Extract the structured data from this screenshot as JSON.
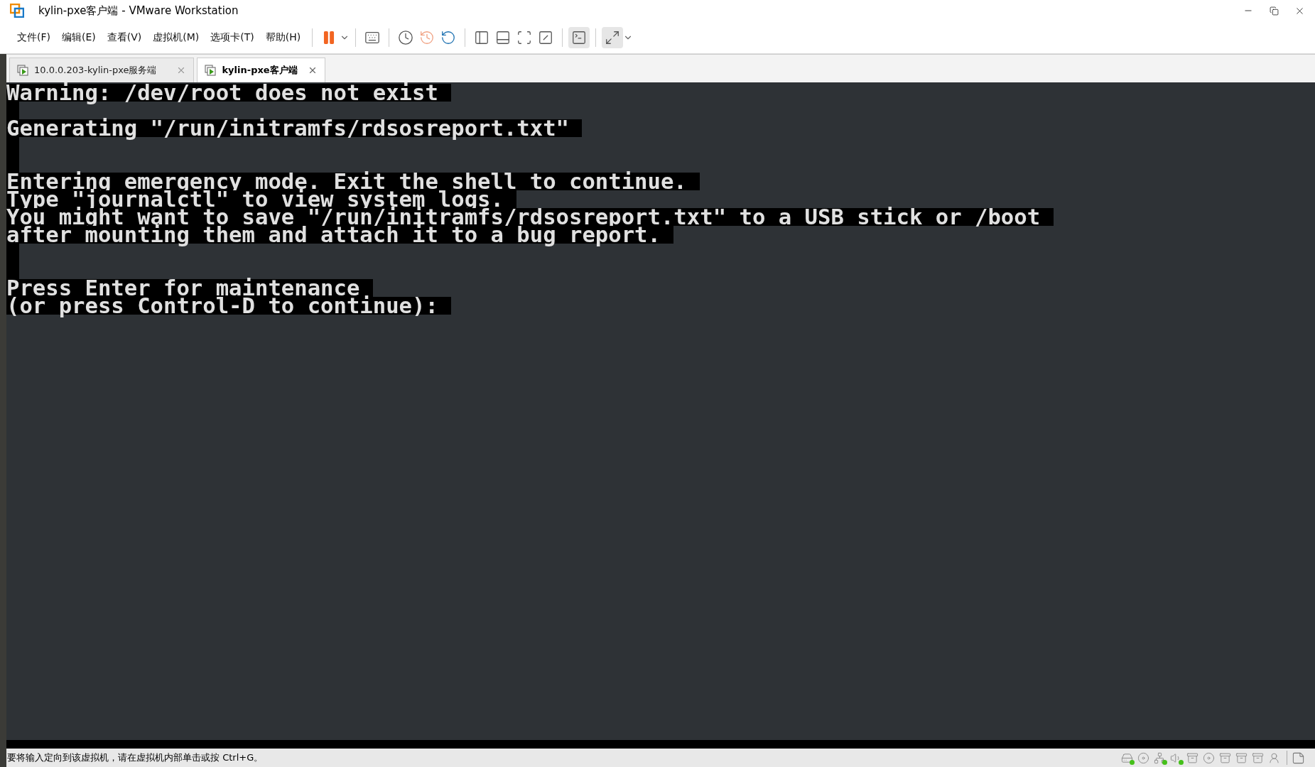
{
  "window": {
    "title": "kylin-pxe客户端 - VMware Workstation"
  },
  "menu": [
    "文件(F)",
    "编辑(E)",
    "查看(V)",
    "虚拟机(M)",
    "选项卡(T)",
    "帮助(H)"
  ],
  "tabs": [
    {
      "label": "10.0.0.203-kylin-pxe服务端",
      "selected": false
    },
    {
      "label": "kylin-pxe客户端",
      "selected": true
    }
  ],
  "console": {
    "lines": [
      {
        "kind": "text",
        "text": "Warning: /dev/root does not exist "
      },
      {
        "kind": "blank"
      },
      {
        "kind": "text",
        "text": "Generating \"/run/initramfs/rdsosreport.txt\" "
      },
      {
        "kind": "blank"
      },
      {
        "kind": "blank"
      },
      {
        "kind": "text",
        "text": "Entering emergency mode. Exit the shell to continue. "
      },
      {
        "kind": "text",
        "text": "Type \"journalctl\" to view system logs. "
      },
      {
        "kind": "text",
        "text": "You might want to save \"/run/initramfs/rdsosreport.txt\" to a USB stick or /boot "
      },
      {
        "kind": "text",
        "text": "after mounting them and attach it to a bug report. "
      },
      {
        "kind": "blank"
      },
      {
        "kind": "blank"
      },
      {
        "kind": "text",
        "text": "Press Enter for maintenance "
      },
      {
        "kind": "text",
        "text": "(or press Control-D to continue): "
      }
    ]
  },
  "status_bar": {
    "message": "要将输入定向到该虚拟机，请在虚拟机内部单击或按 Ctrl+G。",
    "devices": [
      {
        "kind": "disk",
        "active": true
      },
      {
        "kind": "cd",
        "active": false
      },
      {
        "kind": "network",
        "active": true
      },
      {
        "kind": "sound",
        "active": true
      },
      {
        "kind": "drive",
        "active": false
      },
      {
        "kind": "cd",
        "active": false
      },
      {
        "kind": "drive",
        "active": false
      },
      {
        "kind": "drive",
        "active": false
      },
      {
        "kind": "drive",
        "active": false
      },
      {
        "kind": "user",
        "active": false
      }
    ]
  }
}
